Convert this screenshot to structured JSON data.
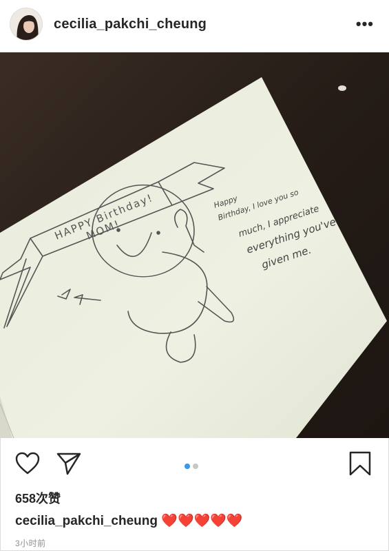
{
  "post": {
    "username": "cecilia_pakchi_cheung",
    "more_label": "•••",
    "likes": "658次赞",
    "caption_user": "cecilia_pakchi_cheung",
    "caption_text": "❤️❤️❤️❤️❤️",
    "time": "3小时前"
  },
  "photo": {
    "banner_text": "HAPPY Birthday!",
    "banner_sub": "MOM!",
    "message_lines": [
      "Happy",
      "Birthday, I love you so",
      "much, I appreciate",
      "everything you've",
      "given me."
    ]
  },
  "carousel": {
    "count": 2,
    "active": 0
  },
  "colors": {
    "accent": "#3897f0",
    "inactive_dot": "#c7c7c7",
    "text": "#262626",
    "muted": "#8e8e8e"
  },
  "icons": [
    "heart-icon",
    "send-icon",
    "bookmark-icon",
    "more-icon"
  ]
}
